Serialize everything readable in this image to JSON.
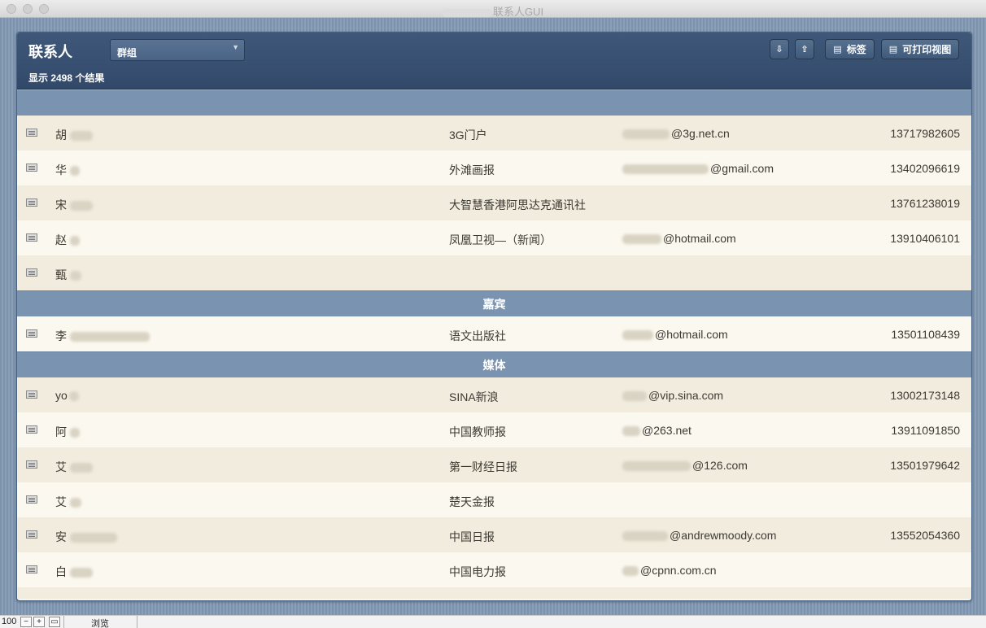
{
  "window": {
    "title": "联系人GUI"
  },
  "header": {
    "title": "联系人",
    "group_select": "群组",
    "result_count": "显示 2498 个结果",
    "buttons": {
      "labels": "标签",
      "print_view": "可打印视图"
    }
  },
  "rows_a": [
    {
      "name": "胡",
      "org": "3G门户",
      "email": "@3g.net.cn",
      "phone": "13717982605"
    },
    {
      "name": "华",
      "org": "外滩画报",
      "email": "@gmail.com",
      "phone": "13402096619"
    },
    {
      "name": "宋",
      "org": "大智慧香港阿思达克通讯社",
      "email": "",
      "phone": "13761238019"
    },
    {
      "name": "赵",
      "org": "凤凰卫视—（新闻）",
      "email": "@hotmail.com",
      "phone": "13910406101"
    },
    {
      "name": "甄",
      "org": "",
      "email": "",
      "phone": ""
    }
  ],
  "section_1": "嘉宾",
  "rows_b": [
    {
      "name": "李",
      "org": "语文出版社",
      "email": "@hotmail.com",
      "phone": "13501108439"
    }
  ],
  "section_2": "媒体",
  "rows_c": [
    {
      "name": "yo",
      "org": "SINA新浪",
      "email": "@vip.sina.com",
      "phone": "13002173148"
    },
    {
      "name": "阿",
      "org": "中国教师报",
      "email": "@263.net",
      "phone": "13911091850"
    },
    {
      "name": "艾",
      "org": "第一财经日报",
      "email": "@126.com",
      "phone": "13501979642"
    },
    {
      "name": "艾",
      "org": "楚天金报",
      "email": "",
      "phone": ""
    },
    {
      "name": "安",
      "org": "中国日报",
      "email": "@andrewmoody.com",
      "phone": "13552054360"
    },
    {
      "name": "白",
      "org": "中国电力报",
      "email": "@cpnn.com.cn",
      "phone": ""
    }
  ],
  "statusbar": {
    "zoom": "100",
    "mode": "浏览"
  }
}
